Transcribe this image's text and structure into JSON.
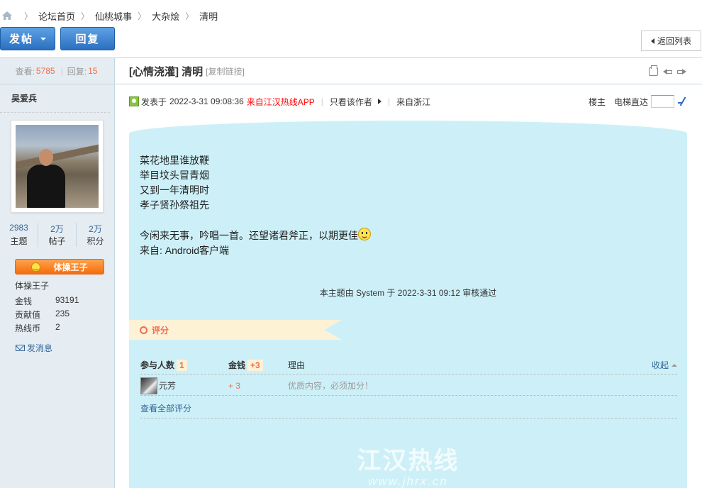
{
  "breadcrumb": {
    "items": [
      "论坛首页",
      "仙桃城事",
      "大杂烩",
      "清明"
    ],
    "separator": "〉"
  },
  "toolbar": {
    "post_label": "发帖",
    "reply_label": "回复",
    "back_label": "返回列表"
  },
  "thread": {
    "views_label": "查看:",
    "views": "5785",
    "replies_label": "回复:",
    "replies": "15",
    "title": "[心情浇灌] 清明",
    "copy_link": "[复制链接]"
  },
  "author": {
    "name": "吴爱兵",
    "stats": [
      {
        "value": "2983",
        "label": "主题"
      },
      {
        "value": "2万",
        "label": "帖子"
      },
      {
        "value": "2万",
        "label": "积分"
      }
    ],
    "rank": "体操王子",
    "rank_text": "体操王子",
    "info": [
      {
        "key": "金钱",
        "value": "93191"
      },
      {
        "key": "贡献值",
        "value": "235"
      },
      {
        "key": "热线币",
        "value": "2"
      }
    ],
    "send_message": "发消息"
  },
  "post": {
    "posted_prefix": "发表于",
    "posted_time": "2022-3-31 09:08:36",
    "source_app": "来自江汉热线APP",
    "only_author": "只看该作者",
    "location": "来自浙江",
    "floor": "楼主",
    "elevator": "电梯直达",
    "poem_lines": [
      "菜花地里谁放鞭",
      "举目坟头冒青烟",
      "又到一年清明时",
      "孝子贤孙祭祖先"
    ],
    "note": "今闲来无事，吟唱一首。还望诸君斧正，以期更佳",
    "from_client": "来自: Android客户端",
    "audit": "本主题由 System 于 2022-3-31 09:12 审核通过"
  },
  "rating": {
    "tag": "评分",
    "participants_label": "参与人数",
    "participants": "1",
    "money_label": "金钱",
    "money_total": "+3",
    "reason_label": "理由",
    "collapse": "收起",
    "rows": [
      {
        "user": "元芳",
        "money": "+ 3",
        "reason": "优质内容，必须加分！"
      }
    ],
    "view_all": "查看全部评分"
  },
  "watermark": {
    "title": "江汉热线",
    "url": "www.jhrx.cn"
  },
  "colors": {
    "accent_blue": "#2b6fc1",
    "highlight_orange": "#f26c4f",
    "paper_bg": "#cdf0f8"
  }
}
